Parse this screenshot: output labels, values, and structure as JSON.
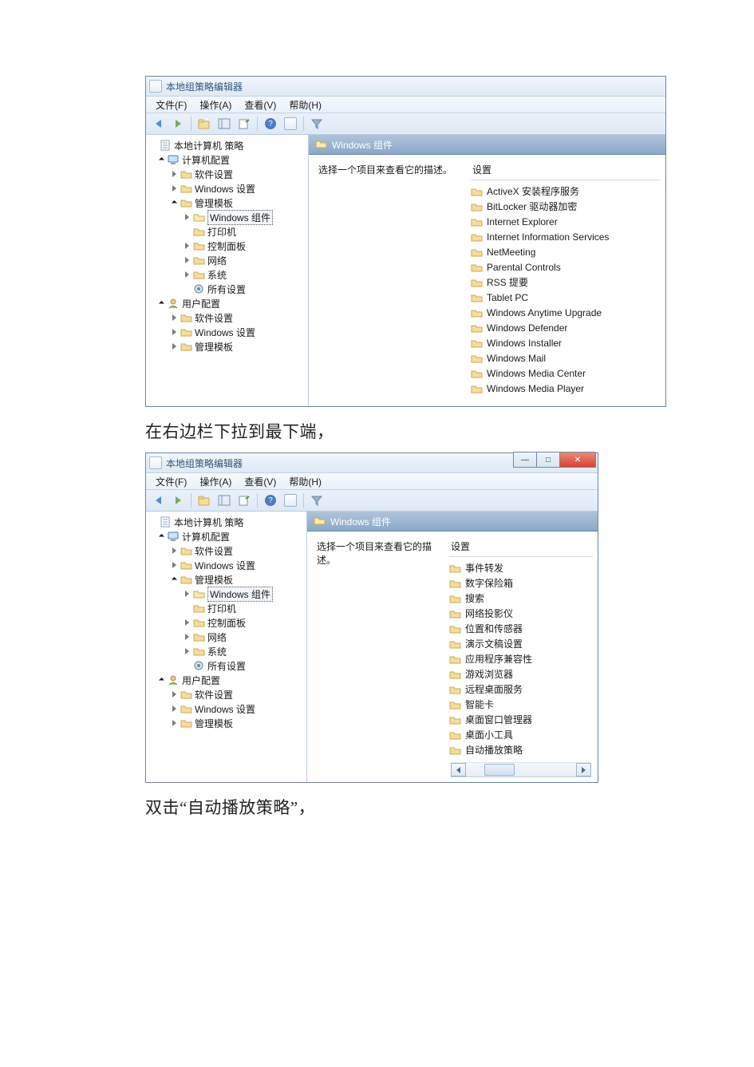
{
  "text1": "在右边栏下拉到最下端，",
  "text2": "双击“自动播放策略”，",
  "win1": {
    "title": "本地组策略编辑器",
    "menu": [
      "文件(F)",
      "操作(A)",
      "查看(V)",
      "帮助(H)"
    ],
    "tree_root": "本地计算机 策略",
    "tree": {
      "computer": "计算机配置",
      "soft": "软件设置",
      "winset": "Windows 设置",
      "admin": "管理模板",
      "wincomp": "Windows 组件",
      "printer": "打印机",
      "ctrl": "控制面板",
      "net": "网络",
      "sys": "系统",
      "allset": "所有设置",
      "user": "用户配置",
      "usoft": "软件设置",
      "uwinset": "Windows 设置",
      "uadmin": "管理模板"
    },
    "panel_title": "Windows 组件",
    "panel_desc": "选择一个项目来查看它的描述。",
    "col_settings": "设置",
    "items": [
      "ActiveX 安装程序服务",
      "BitLocker 驱动器加密",
      "Internet Explorer",
      "Internet Information Services",
      "NetMeeting",
      "Parental Controls",
      "RSS 提要",
      "Tablet PC",
      "Windows Anytime Upgrade",
      "Windows Defender",
      "Windows Installer",
      "Windows Mail",
      "Windows Media Center",
      "Windows Media Player"
    ]
  },
  "win2": {
    "title": "本地组策略编辑器",
    "menu": [
      "文件(F)",
      "操作(A)",
      "查看(V)",
      "帮助(H)"
    ],
    "tree_root": "本地计算机 策略",
    "tree": {
      "computer": "计算机配置",
      "soft": "软件设置",
      "winset": "Windows 设置",
      "admin": "管理模板",
      "wincomp": "Windows 组件",
      "printer": "打印机",
      "ctrl": "控制面板",
      "net": "网络",
      "sys": "系统",
      "allset": "所有设置",
      "user": "用户配置",
      "usoft": "软件设置",
      "uwinset": "Windows 设置",
      "uadmin": "管理模板"
    },
    "panel_title": "Windows 组件",
    "panel_desc": "选择一个项目来查看它的描述。",
    "col_settings": "设置",
    "items": [
      "事件转发",
      "数字保险箱",
      "搜索",
      "网络投影仪",
      "位置和传感器",
      "演示文稿设置",
      "应用程序兼容性",
      "游戏浏览器",
      "远程桌面服务",
      "智能卡",
      "桌面窗口管理器",
      "桌面小工具",
      "自动播放策略"
    ]
  }
}
